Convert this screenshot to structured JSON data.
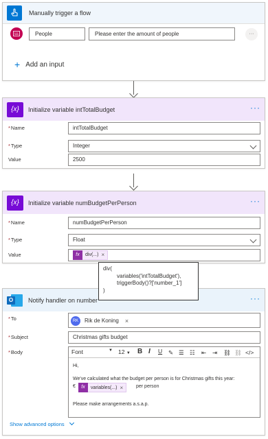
{
  "trigger": {
    "title": "Manually trigger a flow",
    "input_label": "People",
    "input_placeholder": "Please enter the amount of people",
    "input_menu": "···",
    "add_input": "Add an input",
    "add_icon": "+"
  },
  "init1": {
    "icon": "{x}",
    "title": "Initialize variable intTotalBudget",
    "name_label": "Name",
    "name_value": "intTotalBudget",
    "type_label": "Type",
    "type_value": "Integer",
    "value_label": "Value",
    "value_value": "2500"
  },
  "init2": {
    "icon": "{x}",
    "title": "Initialize variable numBudgetPerPerson",
    "name_label": "Name",
    "name_value": "numBudgetPerPerson",
    "type_label": "Type",
    "type_value": "Float",
    "value_label": "Value",
    "value_token": "div(...)"
  },
  "tooltip": {
    "line1": "div(",
    "line2": "variables('intTotalBudget'),",
    "line3": "triggerBody()?['number_1']",
    "line4": ")"
  },
  "notify": {
    "title": "Notify handler on number",
    "to_label": "To",
    "to_initials": "RK",
    "to_name": "Rik de Koning",
    "subject_label": "Subject",
    "subject_value": "Christmas gifts budget",
    "body_label": "Body",
    "font_label": "Font",
    "font_size": "12",
    "body_line1": "Hi,",
    "body_line2": "We've calculated what the budget per person is for Christmas gifts this year:",
    "currency": "€",
    "body_token": "variables(...)",
    "per_person": "per person",
    "body_line4": "Please make arrangements a.s.a.p.",
    "advanced": "Show advanced options"
  },
  "common": {
    "more": "···",
    "required": "*",
    "fx": "fx",
    "remove": "×"
  },
  "colors": {
    "trigger_blue": "#0078d4",
    "variable_purple": "#770bd6",
    "variable_header_bg": "#f1e5fb",
    "outlook_header_bg": "#eaf3fb",
    "outlook_icon": "#0f6cbd"
  }
}
